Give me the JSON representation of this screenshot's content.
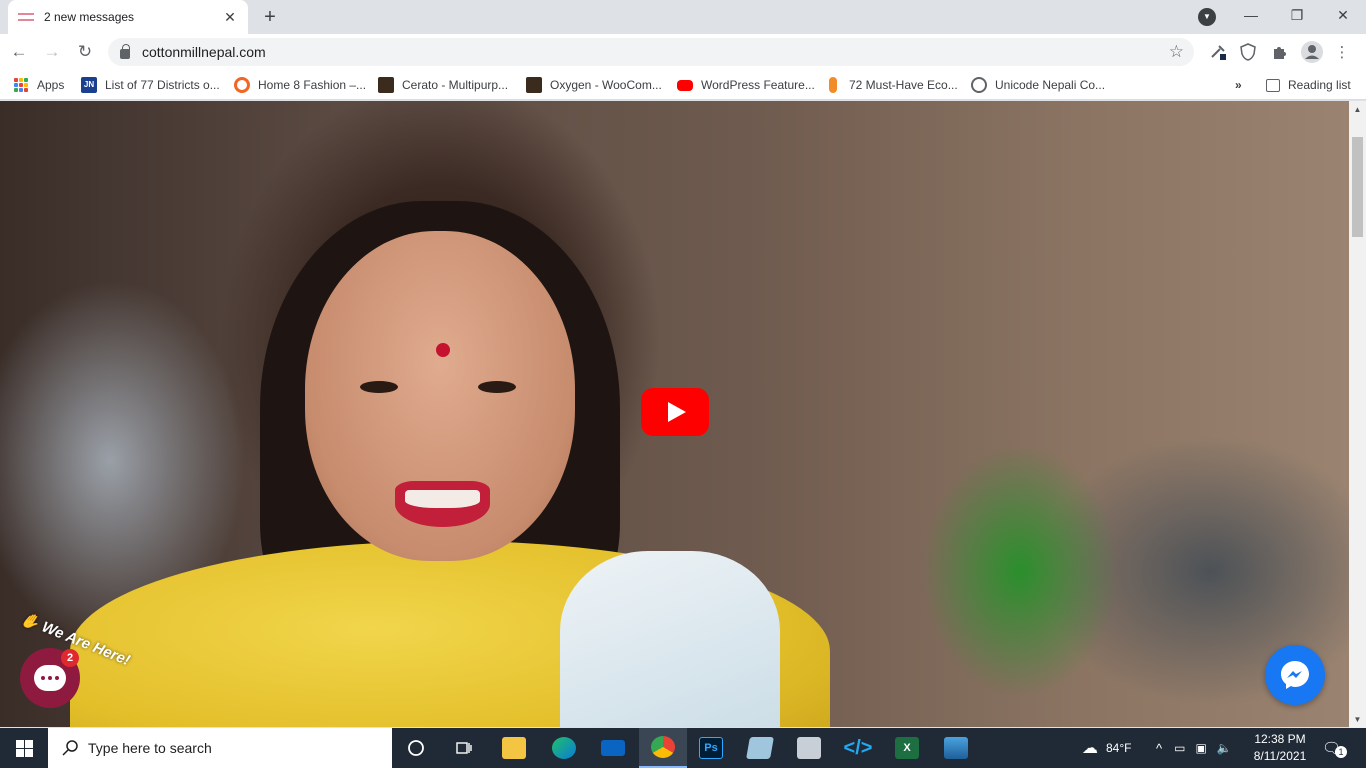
{
  "browser": {
    "tab": {
      "title": "2 new messages",
      "close_icon": "close-icon"
    },
    "address": {
      "url": "cottonmillnepal.com"
    },
    "bookmarks": [
      {
        "label": "Apps",
        "icon": "apps-grid-icon"
      },
      {
        "label": "List of 77 Districts o...",
        "icon": "site-icon",
        "color": "#1a3f8f"
      },
      {
        "label": "Home 8 Fashion –...",
        "icon": "site-icon",
        "color": "#f26522"
      },
      {
        "label": "Cerato - Multipurp...",
        "icon": "site-icon",
        "color": "#3a2b1c"
      },
      {
        "label": "Oxygen - WooCom...",
        "icon": "site-icon",
        "color": "#3a2b1c"
      },
      {
        "label": "WordPress Feature...",
        "icon": "youtube-icon",
        "color": "#ff0000"
      },
      {
        "label": "72 Must-Have Eco...",
        "icon": "site-icon",
        "color": "#f28c28"
      },
      {
        "label": "Unicode Nepali Co...",
        "icon": "globe-icon",
        "color": "#5f6368"
      }
    ],
    "overflow_label": "»",
    "reading_list": "Reading list"
  },
  "page": {
    "chat": {
      "badge_count": "2",
      "banner": "We Are Here!"
    }
  },
  "taskbar": {
    "search_placeholder": "Type here to search",
    "weather": "84°F",
    "time": "12:38 PM",
    "date": "8/11/2021",
    "notification_count": "1"
  },
  "colors": {
    "accent": "#ff0000",
    "chat": "#8e1b3f",
    "messenger": "#1877f2",
    "taskbar": "#1f2a36"
  }
}
